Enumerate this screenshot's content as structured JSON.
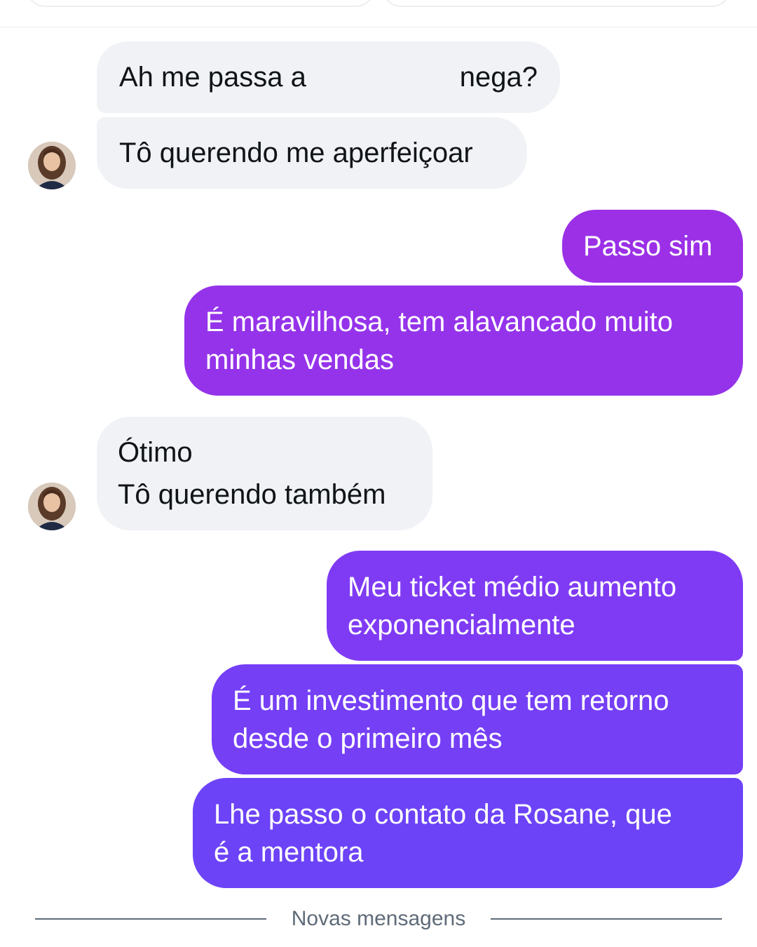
{
  "messages": [
    {
      "direction": "incoming",
      "text_before": "Ah me passa a",
      "text_after": "nega?"
    },
    {
      "direction": "incoming",
      "text": "Tô querendo me aperfeiçoar"
    },
    {
      "direction": "outgoing",
      "text": "Passo sim",
      "color": "#9b30e6"
    },
    {
      "direction": "outgoing",
      "lines": [
        "É maravilhosa, tem alavancado muito",
        "minhas vendas"
      ],
      "color": "#9533ea"
    },
    {
      "direction": "incoming",
      "lines": [
        "Ótimo",
        "Tô querendo também"
      ]
    },
    {
      "direction": "outgoing",
      "lines": [
        "Meu ticket médio aumento",
        "exponencialmente"
      ],
      "color": "#7f3bf4"
    },
    {
      "direction": "outgoing",
      "lines": [
        "É um investimento que tem retorno",
        "desde o primeiro mês"
      ],
      "color": "#753ff6"
    },
    {
      "direction": "outgoing",
      "lines": [
        "Lhe passo o contato da Rosane, que",
        "é a mentora"
      ],
      "color": "#6c43f7"
    }
  ],
  "divider": {
    "label": "Novas mensagens"
  },
  "colors": {
    "incoming_bubble": "#f0f2f5",
    "outgoing_gradient_top": "#9b30e6",
    "outgoing_gradient_bottom": "#6c43f7",
    "divider_text": "#5f6b78"
  },
  "avatar": {
    "icon": "user-avatar-photo"
  }
}
